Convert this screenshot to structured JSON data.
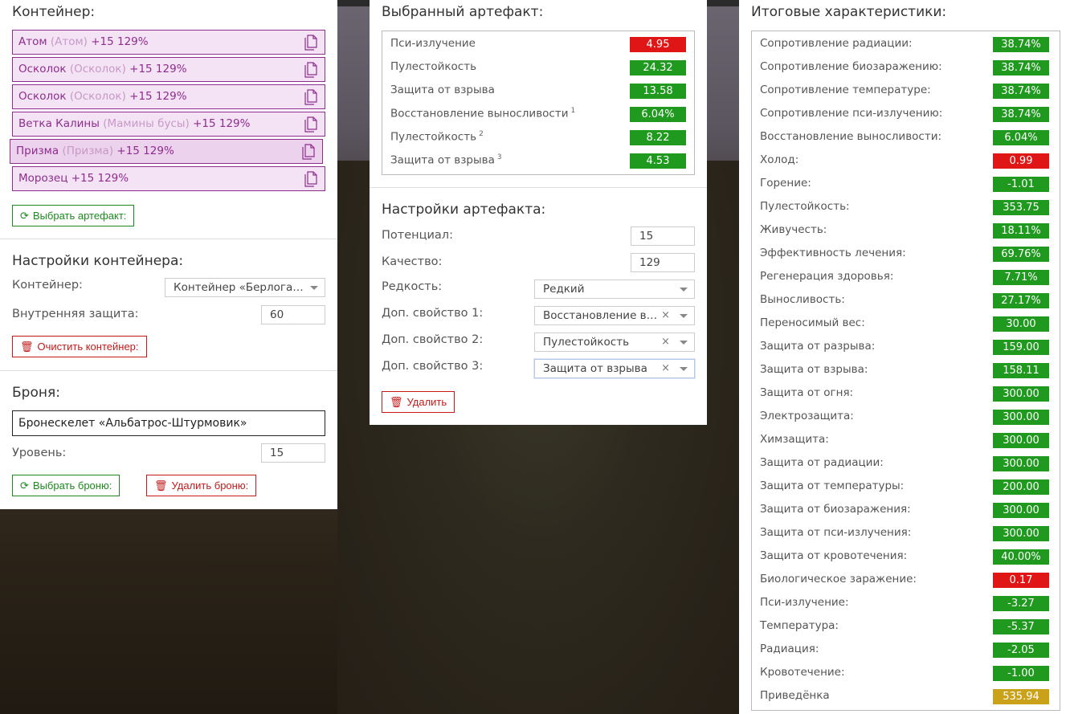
{
  "container": {
    "title": "Контейнер:",
    "slots": [
      {
        "name": "Атом",
        "source": "(Атом)",
        "bonus": "+15 129%"
      },
      {
        "name": "Осколок",
        "source": "(Осколок)",
        "bonus": "+15 129%"
      },
      {
        "name": "Осколок",
        "source": "(Осколок)",
        "bonus": "+15 129%"
      },
      {
        "name": "Ветка Калины",
        "source": "(Мамины бусы)",
        "bonus": "+15 129%"
      },
      {
        "name": "Призма",
        "source": "(Призма)",
        "bonus": "+15 129%"
      },
      {
        "name": "Морозец",
        "source": "",
        "bonus": "+15 129%"
      }
    ],
    "choose_button": "Выбрать артефакт:"
  },
  "container_settings": {
    "title": "Настройки контейнера:",
    "container_label": "Контейнер:",
    "container_value": "Контейнер «Берлога…",
    "inner_protection_label": "Внутренняя защита:",
    "inner_protection_value": "60",
    "clear_button": "Очистить контейнер:"
  },
  "armor": {
    "title": "Броня:",
    "value": "Бронескелет «Альбатрос-Штурмовик»",
    "level_label": "Уровень:",
    "level_value": "15",
    "choose_button": "Выбрать броню:",
    "remove_button": "Удалить броню:"
  },
  "selected_artifact": {
    "title": "Выбранный артефакт:",
    "stats": [
      {
        "name": "Пси-излучение",
        "sup": "",
        "value": "4.95",
        "color": "#e01616"
      },
      {
        "name": "Пулестойкость",
        "sup": "",
        "value": "24.32",
        "color": "#1f9a1f"
      },
      {
        "name": "Защита от взрыва",
        "sup": "",
        "value": "13.58",
        "color": "#1f9a1f"
      },
      {
        "name": "Восстановление выносливости",
        "sup": "1",
        "value": "6.04%",
        "color": "#1f9a1f"
      },
      {
        "name": "Пулестойкость",
        "sup": "2",
        "value": "8.22",
        "color": "#1f9a1f"
      },
      {
        "name": "Защита от взрыва",
        "sup": "3",
        "value": "4.53",
        "color": "#1f9a1f"
      }
    ]
  },
  "artifact_settings": {
    "title": "Настройки артефакта:",
    "potential_label": "Потенциал:",
    "potential_value": "15",
    "quality_label": "Качество:",
    "quality_value": "129",
    "rarity_label": "Редкость:",
    "rarity_value": "Редкий",
    "prop1_label": "Доп. свойство 1:",
    "prop1_value": "Восстановление в…",
    "prop2_label": "Доп. свойство 2:",
    "prop2_value": "Пулестойкость",
    "prop3_label": "Доп. свойство 3:",
    "prop3_value": "Защита от взрыва",
    "clear_symbol": "×",
    "delete_button": "Удалить"
  },
  "totals": {
    "title": "Итоговые характеристики:",
    "stats": [
      {
        "name": "Сопротивление радиации:",
        "value": "38.74%",
        "color": "#1f9a1f"
      },
      {
        "name": "Сопротивление биозаражению:",
        "value": "38.74%",
        "color": "#1f9a1f"
      },
      {
        "name": "Сопротивление температуре:",
        "value": "38.74%",
        "color": "#1f9a1f"
      },
      {
        "name": "Сопротивление пси-излучению:",
        "value": "38.74%",
        "color": "#1f9a1f"
      },
      {
        "name": "Восстановление выносливости:",
        "value": "6.04%",
        "color": "#1f9a1f"
      },
      {
        "name": "Холод:",
        "value": "0.99",
        "color": "#e01616"
      },
      {
        "name": "Горение:",
        "value": "-1.01",
        "color": "#1f9a1f"
      },
      {
        "name": "Пулестойкость:",
        "value": "353.75",
        "color": "#1f9a1f"
      },
      {
        "name": "Живучесть:",
        "value": "18.11%",
        "color": "#1f9a1f"
      },
      {
        "name": "Эффективность лечения:",
        "value": "69.76%",
        "color": "#1f9a1f"
      },
      {
        "name": "Регенерация здоровья:",
        "value": "7.71%",
        "color": "#1f9a1f"
      },
      {
        "name": "Выносливость:",
        "value": "27.17%",
        "color": "#1f9a1f"
      },
      {
        "name": "Переносимый вес:",
        "value": "30.00",
        "color": "#1f9a1f"
      },
      {
        "name": "Защита от разрыва:",
        "value": "159.00",
        "color": "#1f9a1f"
      },
      {
        "name": "Защита от взрыва:",
        "value": "158.11",
        "color": "#1f9a1f"
      },
      {
        "name": "Защита от огня:",
        "value": "300.00",
        "color": "#1f9a1f"
      },
      {
        "name": "Электрозащита:",
        "value": "300.00",
        "color": "#1f9a1f"
      },
      {
        "name": "Химзащита:",
        "value": "300.00",
        "color": "#1f9a1f"
      },
      {
        "name": "Защита от радиации:",
        "value": "300.00",
        "color": "#1f9a1f"
      },
      {
        "name": "Защита от температуры:",
        "value": "200.00",
        "color": "#1f9a1f"
      },
      {
        "name": "Защита от биозаражения:",
        "value": "300.00",
        "color": "#1f9a1f"
      },
      {
        "name": "Защита от пси-излучения:",
        "value": "300.00",
        "color": "#1f9a1f"
      },
      {
        "name": "Защита от кровотечения:",
        "value": "40.00%",
        "color": "#1f9a1f"
      },
      {
        "name": "Биологическое заражение:",
        "value": "0.17",
        "color": "#e01616"
      },
      {
        "name": "Пси-излучение:",
        "value": "-3.27",
        "color": "#1f9a1f"
      },
      {
        "name": "Температура:",
        "value": "-5.37",
        "color": "#1f9a1f"
      },
      {
        "name": "Радиация:",
        "value": "-2.05",
        "color": "#1f9a1f"
      },
      {
        "name": "Кровотечение:",
        "value": "-1.00",
        "color": "#1f9a1f"
      },
      {
        "name": "Приведёнка",
        "value": "535.94",
        "color": "#c9a21a"
      }
    ]
  }
}
